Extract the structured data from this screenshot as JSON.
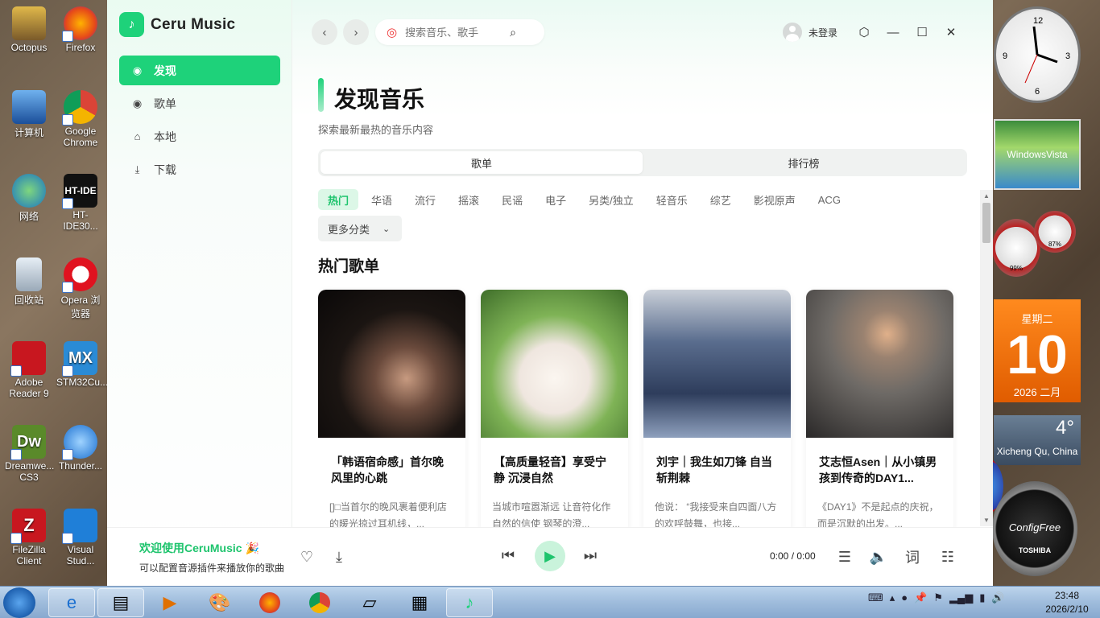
{
  "desktop": {
    "icons_col1": [
      "Octopus",
      "计算机",
      "网络",
      "回收站",
      "Adobe Reader 9",
      "Dreamwe... CS3",
      "FileZilla Client"
    ],
    "icons_col2": [
      "Firefox",
      "Google Chrome",
      "HT-IDE30...",
      "Opera 浏览器",
      "STM32Cu...",
      "Thunder...",
      "Visual Stud..."
    ]
  },
  "gadgets": {
    "vista_label": "WindowsVista",
    "meter_cpu": "99%",
    "meter_mem": "87%",
    "calendar_day": "星期二",
    "calendar_num": "10",
    "calendar_ym": "2026 二月",
    "weather_temp": "4°",
    "weather_loc": "Xicheng Qu, China",
    "cf_title": "ConfigFree",
    "cf_brand": "TOSHIBA"
  },
  "app": {
    "name": "Ceru Music",
    "nav": [
      {
        "label": "发现",
        "icon": "discover-icon"
      },
      {
        "label": "歌单",
        "icon": "disc-icon"
      },
      {
        "label": "本地",
        "icon": "home-icon"
      },
      {
        "label": "下载",
        "icon": "download-icon"
      }
    ],
    "search": {
      "placeholder": "搜索音乐、歌手"
    },
    "user": "未登录",
    "page": {
      "title": "发现音乐",
      "subtitle": "探索最新最热的音乐内容",
      "segments": [
        "歌单",
        "排行榜"
      ],
      "tags": [
        "热门",
        "华语",
        "流行",
        "摇滚",
        "民谣",
        "电子",
        "另类/独立",
        "轻音乐",
        "综艺",
        "影视原声",
        "ACG"
      ],
      "more": "更多分类",
      "section": "热门歌单",
      "cards": [
        {
          "title": "「韩语宿命感」首尔晚风里的心跳",
          "desc": "[]□当首尔的晚风裹着便利店的暖光掠过耳机线，..."
        },
        {
          "title": "【高质量轻音】享受宁静 沉浸自然",
          "desc": "当城市喧嚣渐远 让音符化作自然的信使 钢琴的澄..."
        },
        {
          "title": "刘宇｜我生如刀锋 自当斩荆棘",
          "desc": "他说：  “我接受来自四面八方的欢呼鼓舞，也接..."
        },
        {
          "title": "艾志恒Asen｜从小镇男孩到传奇的DAY1...",
          "desc": "《DAY1》不是起点的庆祝，而是沉默的出发。..."
        }
      ]
    },
    "player": {
      "title": "欢迎使用CeruMusic 🎉",
      "subtitle": "可以配置音源插件来播放你的歌曲",
      "time": "0:00 / 0:00"
    }
  },
  "taskbar": {
    "time": "23:48",
    "date": "2026/2/10"
  }
}
